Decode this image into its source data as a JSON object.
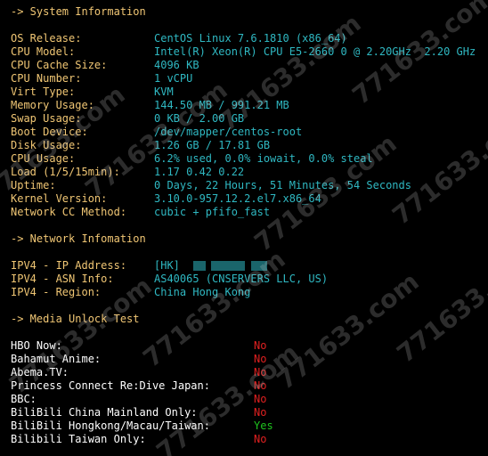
{
  "system": {
    "heading": "-> System Information",
    "rows": [
      {
        "label": "OS Release:",
        "value": "CentOS Linux 7.6.1810 (x86_64)"
      },
      {
        "label": "CPU Model:",
        "value": "Intel(R) Xeon(R) CPU E5-2660 0 @ 2.20GHz  2.20 GHz"
      },
      {
        "label": "CPU Cache Size:",
        "value": "4096 KB"
      },
      {
        "label": "CPU Number:",
        "value": "1 vCPU"
      },
      {
        "label": "Virt Type:",
        "value": "KVM"
      },
      {
        "label": "Memory Usage:",
        "value": "144.50 MB / 991.21 MB"
      },
      {
        "label": "Swap Usage:",
        "value": "0 KB / 2.00 GB"
      },
      {
        "label": "Boot Device:",
        "value": "/dev/mapper/centos-root"
      },
      {
        "label": "Disk Usage:",
        "value": "1.26 GB / 17.81 GB"
      },
      {
        "label": "CPU Usage:",
        "value": "6.2% used, 0.0% iowait, 0.0% steal"
      },
      {
        "label": "Load (1/5/15min):",
        "value": "1.17 0.42 0.22"
      },
      {
        "label": "Uptime:",
        "value": "0 Days, 22 Hours, 51 Minutes, 54 Seconds"
      },
      {
        "label": "Kernel Version:",
        "value": "3.10.0-957.12.2.el7.x86_64"
      },
      {
        "label": "Network CC Method:",
        "value": "cubic + pfifo_fast"
      }
    ]
  },
  "network": {
    "heading": "-> Network Infomation",
    "rows": [
      {
        "label": "IPV4 - IP Address:",
        "value": "[HK]"
      },
      {
        "label": "IPV4 - ASN Info:",
        "value": "AS40065 (CNSERVERS LLC, US)"
      },
      {
        "label": "IPV4 - Region:",
        "value": "China Hong Kong"
      }
    ]
  },
  "media": {
    "heading": "-> Media Unlock Test",
    "rows": [
      {
        "label": "HBO Now:",
        "value": "No",
        "status": "no"
      },
      {
        "label": "Bahamut Anime:",
        "value": "No",
        "status": "no"
      },
      {
        "label": "Abema.TV:",
        "value": "No",
        "status": "no"
      },
      {
        "label": "Princess Connect Re:Dive Japan:",
        "value": "No",
        "status": "no"
      },
      {
        "label": "BBC:",
        "value": "No",
        "status": "no"
      },
      {
        "label": "BiliBili China Mainland Only:",
        "value": "No",
        "status": "no"
      },
      {
        "label": "BiliBili Hongkong/Macau/Taiwan:",
        "value": "Yes",
        "status": "yes"
      },
      {
        "label": "Bilibili Taiwan Only:",
        "value": "No",
        "status": "no"
      }
    ]
  },
  "watermark": {
    "text": "771633.com"
  },
  "colors": {
    "background": "#000000",
    "label": "#f0c674",
    "value": "#2fb8c2",
    "no": "#e02020",
    "yes": "#1ec31e"
  }
}
